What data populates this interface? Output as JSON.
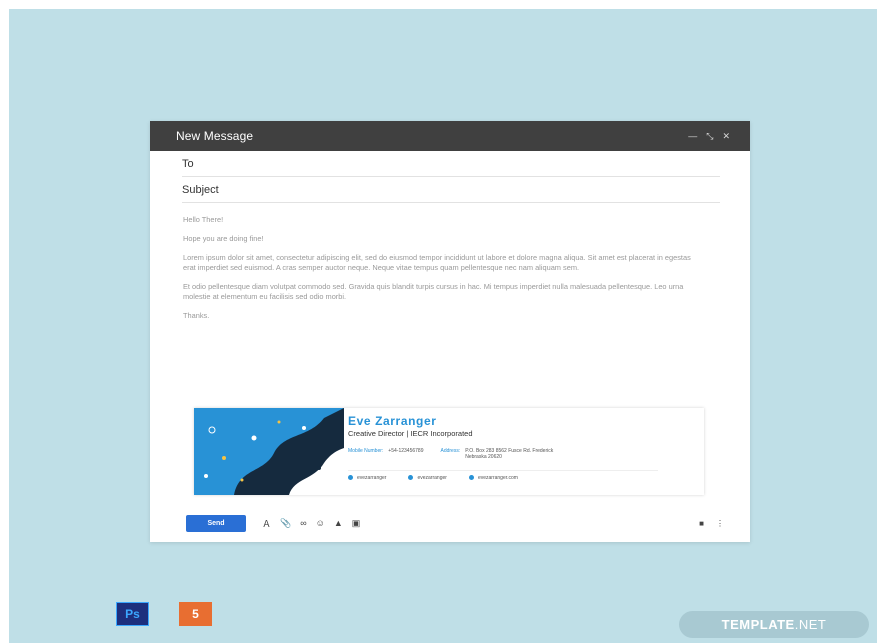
{
  "compose": {
    "title": "New Message",
    "to_label": "To",
    "subject_label": "Subject",
    "body": {
      "greeting": "Hello There!",
      "line1": "Hope you are doing fine!",
      "paragraph1": "Lorem ipsum dolor sit amet, consectetur adipiscing elit, sed do eiusmod tempor incididunt ut labore et dolore magna aliqua. Sit amet est placerat in egestas erat imperdiet sed euismod. A cras semper auctor neque. Neque vitae tempus quam pellentesque nec nam aliquam sem.",
      "paragraph2": "Et odio pellentesque diam volutpat commodo sed. Gravida quis blandit turpis cursus in hac. Mi tempus imperdiet nulla malesuada pellentesque. Leo urna molestie at elementum eu facilisis sed odio morbi.",
      "closing": "Thanks."
    },
    "window_controls": {
      "minimize_icon": "minimize-icon",
      "expand_icon": "expand-icon",
      "close_icon": "close-icon"
    }
  },
  "signature": {
    "name": "Eve Zarranger",
    "role": "Creative Director | IECR Incorporated",
    "mobile_label": "Mobile Number:",
    "mobile_value": "+54-123456789",
    "address_label": "Address:",
    "address_value": "P.O. Box 283 8562 Fusce Rd. Frederick Nebraska 20620",
    "social": [
      {
        "icon": "facebook-icon",
        "handle": "evezarranger"
      },
      {
        "icon": "twitter-icon",
        "handle": "evezarranger"
      },
      {
        "icon": "globe-icon",
        "handle": "evezarranger.com"
      }
    ],
    "colors": {
      "accent": "#2892d6",
      "dark": "#152a3e"
    }
  },
  "toolbar": {
    "send_label": "Send",
    "icons": [
      "format-text-icon",
      "attach-icon",
      "link-icon",
      "emoji-icon",
      "drive-icon",
      "photo-icon"
    ],
    "right_icons": [
      "delete-icon",
      "more-options-icon"
    ]
  },
  "file_types": {
    "ps_label": "Ps",
    "html_label": "5"
  },
  "brand": {
    "name_bold": "TEMPLATE",
    "name_suffix": ".NET"
  },
  "colors": {
    "background": "#bfdfe7",
    "header": "#404040",
    "send_button": "#2a6fd5"
  }
}
